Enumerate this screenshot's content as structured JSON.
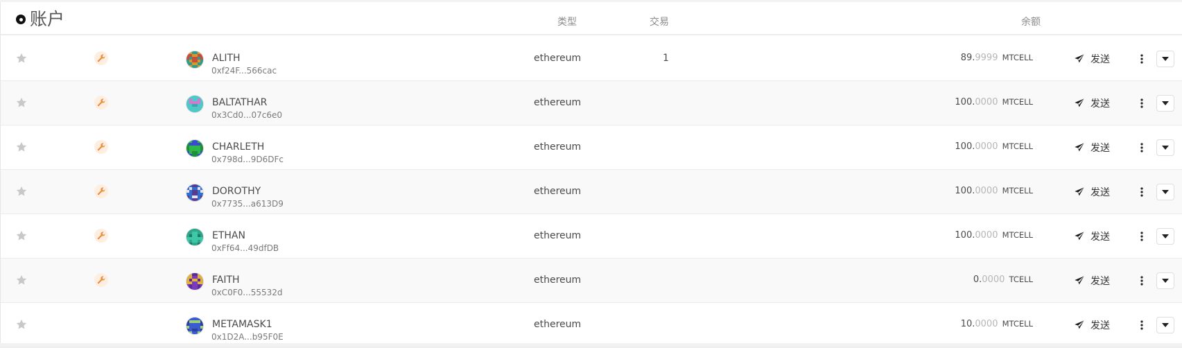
{
  "header": {
    "title": "账户",
    "col_type": "类型",
    "col_transactions": "交易",
    "col_balance": "余额"
  },
  "accounts": [
    {
      "name": "ALITH",
      "address": "0xf24F...566cac",
      "type": "ethereum",
      "tx": "1",
      "bal_int": "89.",
      "bal_dec": "9999",
      "unit": "MTCELL",
      "send_label": "发送",
      "has_wrench": true,
      "avatar_colors": [
        "#2f9b8c",
        "#c94d3b",
        "#d49a2e"
      ]
    },
    {
      "name": "BALTATHAR",
      "address": "0x3Cd0...07c6e0",
      "type": "ethereum",
      "tx": "",
      "bal_int": "100.",
      "bal_dec": "0000",
      "unit": "MTCELL",
      "send_label": "发送",
      "has_wrench": true,
      "avatar_colors": [
        "#4fc8c8",
        "#d07bd0",
        "#3da6b5"
      ]
    },
    {
      "name": "CHARLETH",
      "address": "0x798d...9D6DFc",
      "type": "ethereum",
      "tx": "",
      "bal_int": "100.",
      "bal_dec": "0000",
      "unit": "MTCELL",
      "send_label": "发送",
      "has_wrench": true,
      "avatar_colors": [
        "#2fb84a",
        "#1f8f3a",
        "#3b4bd1"
      ]
    },
    {
      "name": "DOROTHY",
      "address": "0x7735...a613D9",
      "type": "ethereum",
      "tx": "",
      "bal_int": "100.",
      "bal_dec": "0000",
      "unit": "MTCELL",
      "send_label": "发送",
      "has_wrench": true,
      "avatar_colors": [
        "#e7e1f2",
        "#5a3a8c",
        "#2f6fd1"
      ]
    },
    {
      "name": "ETHAN",
      "address": "0xFf64...49dfDB",
      "type": "ethereum",
      "tx": "",
      "bal_int": "100.",
      "bal_dec": "0000",
      "unit": "MTCELL",
      "send_label": "发送",
      "has_wrench": true,
      "avatar_colors": [
        "#2fa58c",
        "#1c7a64",
        "#3fc8a8"
      ]
    },
    {
      "name": "FAITH",
      "address": "0xC0F0...55532d",
      "type": "ethereum",
      "tx": "",
      "bal_int": "0.",
      "bal_dec": "0000",
      "unit": "TCELL",
      "send_label": "发送",
      "has_wrench": true,
      "avatar_colors": [
        "#5b2b9c",
        "#e0b23a",
        "#7a3bbf"
      ]
    },
    {
      "name": "METAMASK1",
      "address": "0x1D2A...b95F0E",
      "type": "ethereum",
      "tx": "",
      "bal_int": "10.",
      "bal_dec": "0000",
      "unit": "MTCELL",
      "send_label": "发送",
      "has_wrench": false,
      "avatar_colors": [
        "#3b5bd1",
        "#9bd17a",
        "#2f3f9c"
      ]
    }
  ],
  "icons": {
    "title_icon": "circle-dot-icon",
    "star": "star-icon",
    "wrench": "wrench-icon",
    "send": "paper-plane-icon",
    "more": "vertical-ellipsis-icon",
    "expand": "caret-down-icon"
  },
  "colors": {
    "wrench_accent": "#f08a35",
    "star_gray": "#c8c8c8",
    "decimal_gray": "#b5b5b5"
  }
}
